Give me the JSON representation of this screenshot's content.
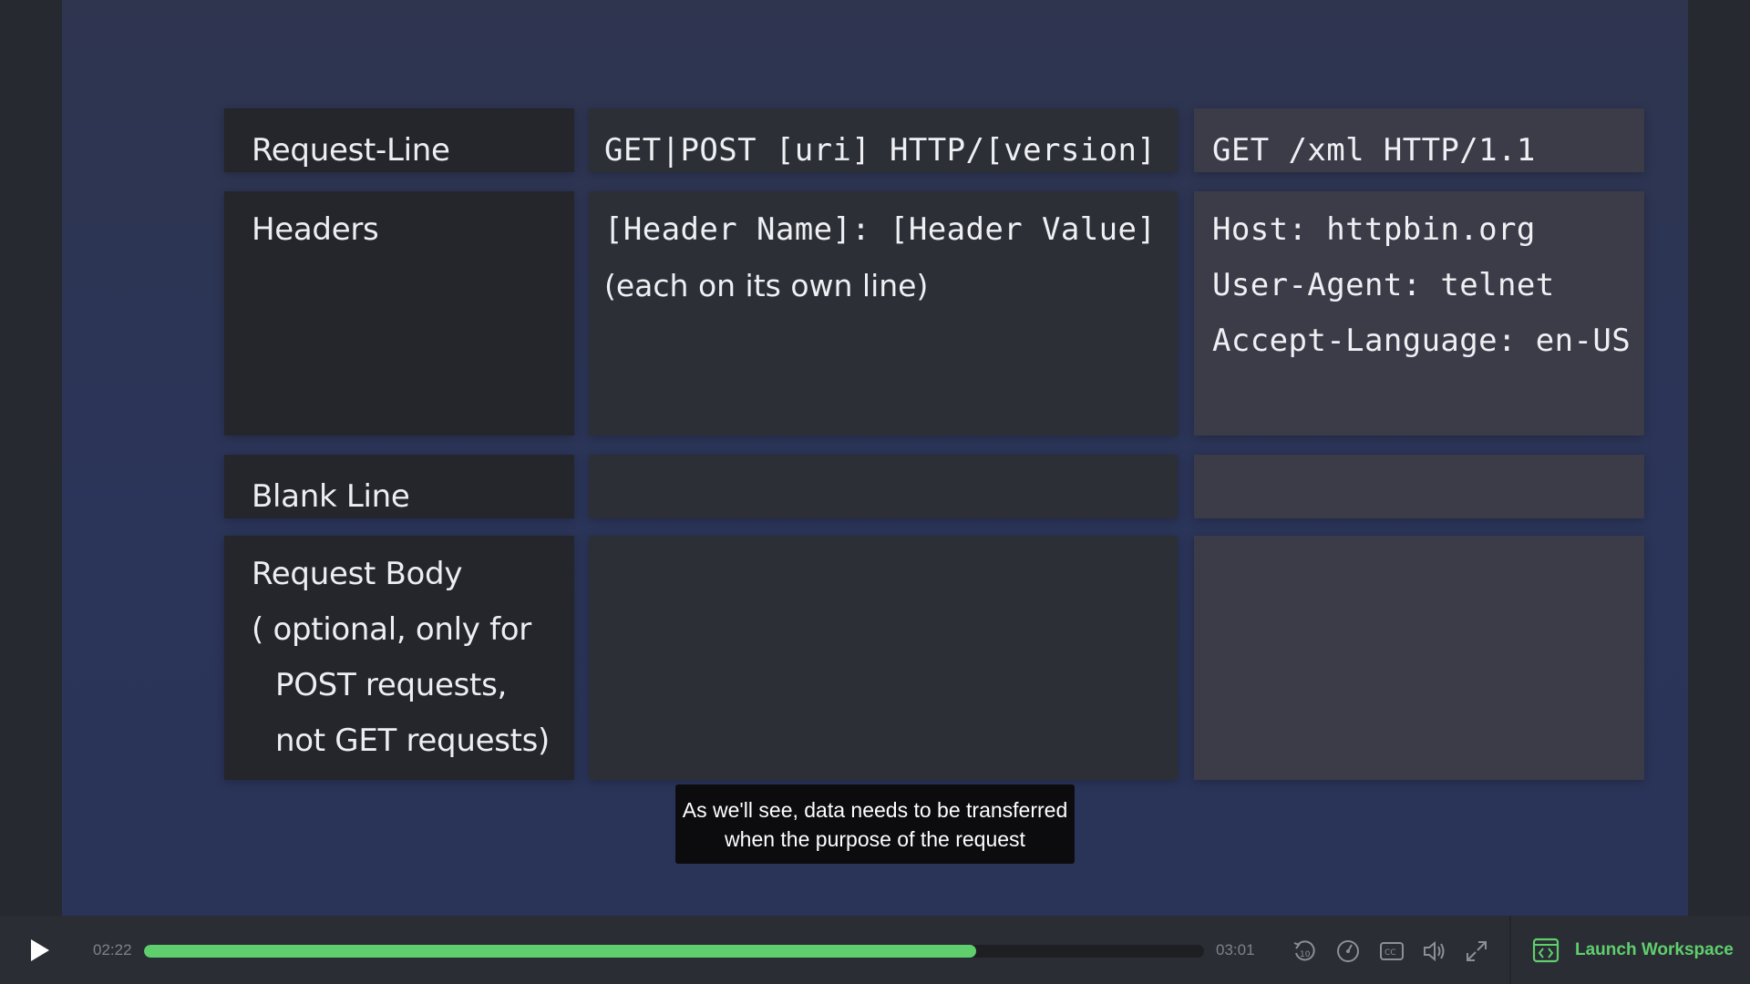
{
  "table": {
    "rows": [
      {
        "label_lines": [
          "Request-Line"
        ],
        "format_lines": [
          "GET|POST [uri] HTTP/[version]"
        ],
        "example_lines": [
          "GET /xml HTTP/1.1"
        ]
      },
      {
        "label_lines": [
          "Headers"
        ],
        "format_lines": [
          "[Header Name]: [Header Value]",
          "(each on its own line)"
        ],
        "example_lines": [
          "Host: httpbin.org",
          "User-Agent: telnet",
          "Accept-Language: en-US"
        ]
      },
      {
        "label_lines": [
          "Blank Line"
        ],
        "format_lines": [],
        "example_lines": []
      },
      {
        "label_lines": [
          "Request Body",
          "( optional, only for",
          "POST requests,",
          "not GET requests)"
        ],
        "format_lines": [],
        "example_lines": []
      }
    ]
  },
  "caption": {
    "line1": "As we'll see, data needs to be transferred",
    "line2": "when the purpose of the request"
  },
  "player": {
    "current_time": "02:22",
    "total_time": "03:01",
    "progress": 0.785,
    "launch_label": "Launch Workspace",
    "accent_color": "#5fcf6e",
    "icons": [
      "play-icon",
      "rewind-10-icon",
      "speed-icon",
      "captions-icon",
      "volume-icon",
      "fullscreen-icon",
      "workspace-icon"
    ]
  }
}
